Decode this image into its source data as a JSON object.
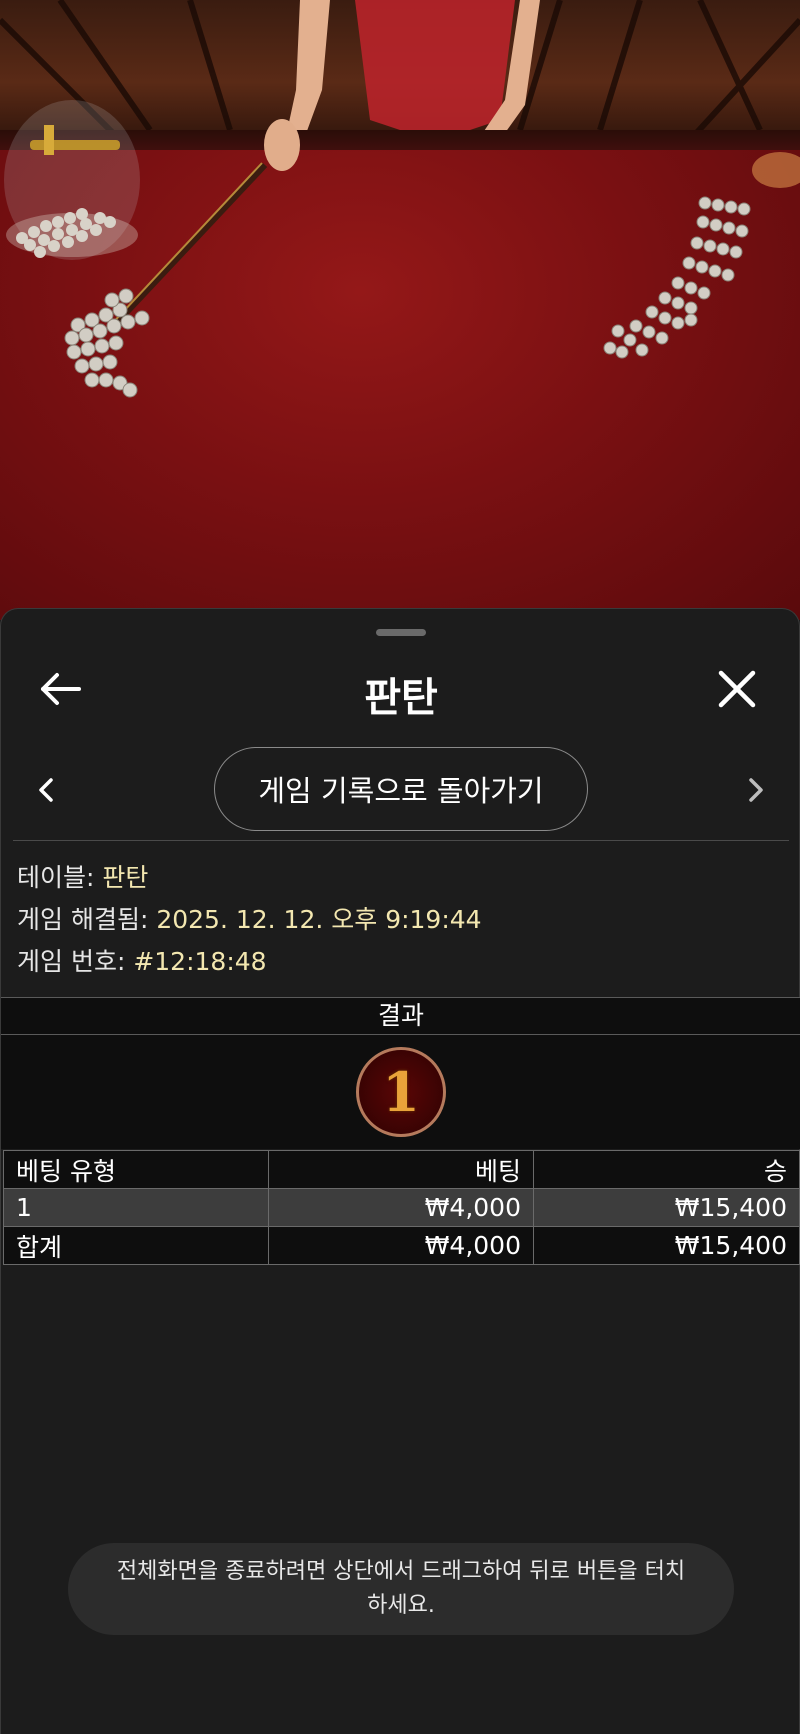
{
  "header": {
    "title": "판탄"
  },
  "navigation": {
    "history_button_label": "게임 기록으로 돌아가기"
  },
  "game_info": {
    "table_label": "테이블:",
    "table_value": "판탄",
    "resolved_label": "게임 해결됨:",
    "resolved_value": "2025. 12. 12. 오후 9:19:44",
    "number_label": "게임 번호:",
    "number_value": "#12:18:48"
  },
  "result": {
    "header": "결과",
    "value": "1"
  },
  "bet_table": {
    "columns": [
      "베팅 유형",
      "베팅",
      "승"
    ],
    "rows": [
      {
        "type": "1",
        "bet": "₩4,000",
        "win": "₩15,400"
      }
    ],
    "total": {
      "type": "합계",
      "bet": "₩4,000",
      "win": "₩15,400"
    }
  },
  "toast": {
    "message": "전체화면을 종료하려면 상단에서 드래그하여 뒤로 버튼을 터치하세요."
  },
  "colors": {
    "sheet_background": "#1c1c1c",
    "info_value": "#f3e7b0",
    "felt_red": "#7a1012",
    "result_gold": "#e9a33a"
  }
}
